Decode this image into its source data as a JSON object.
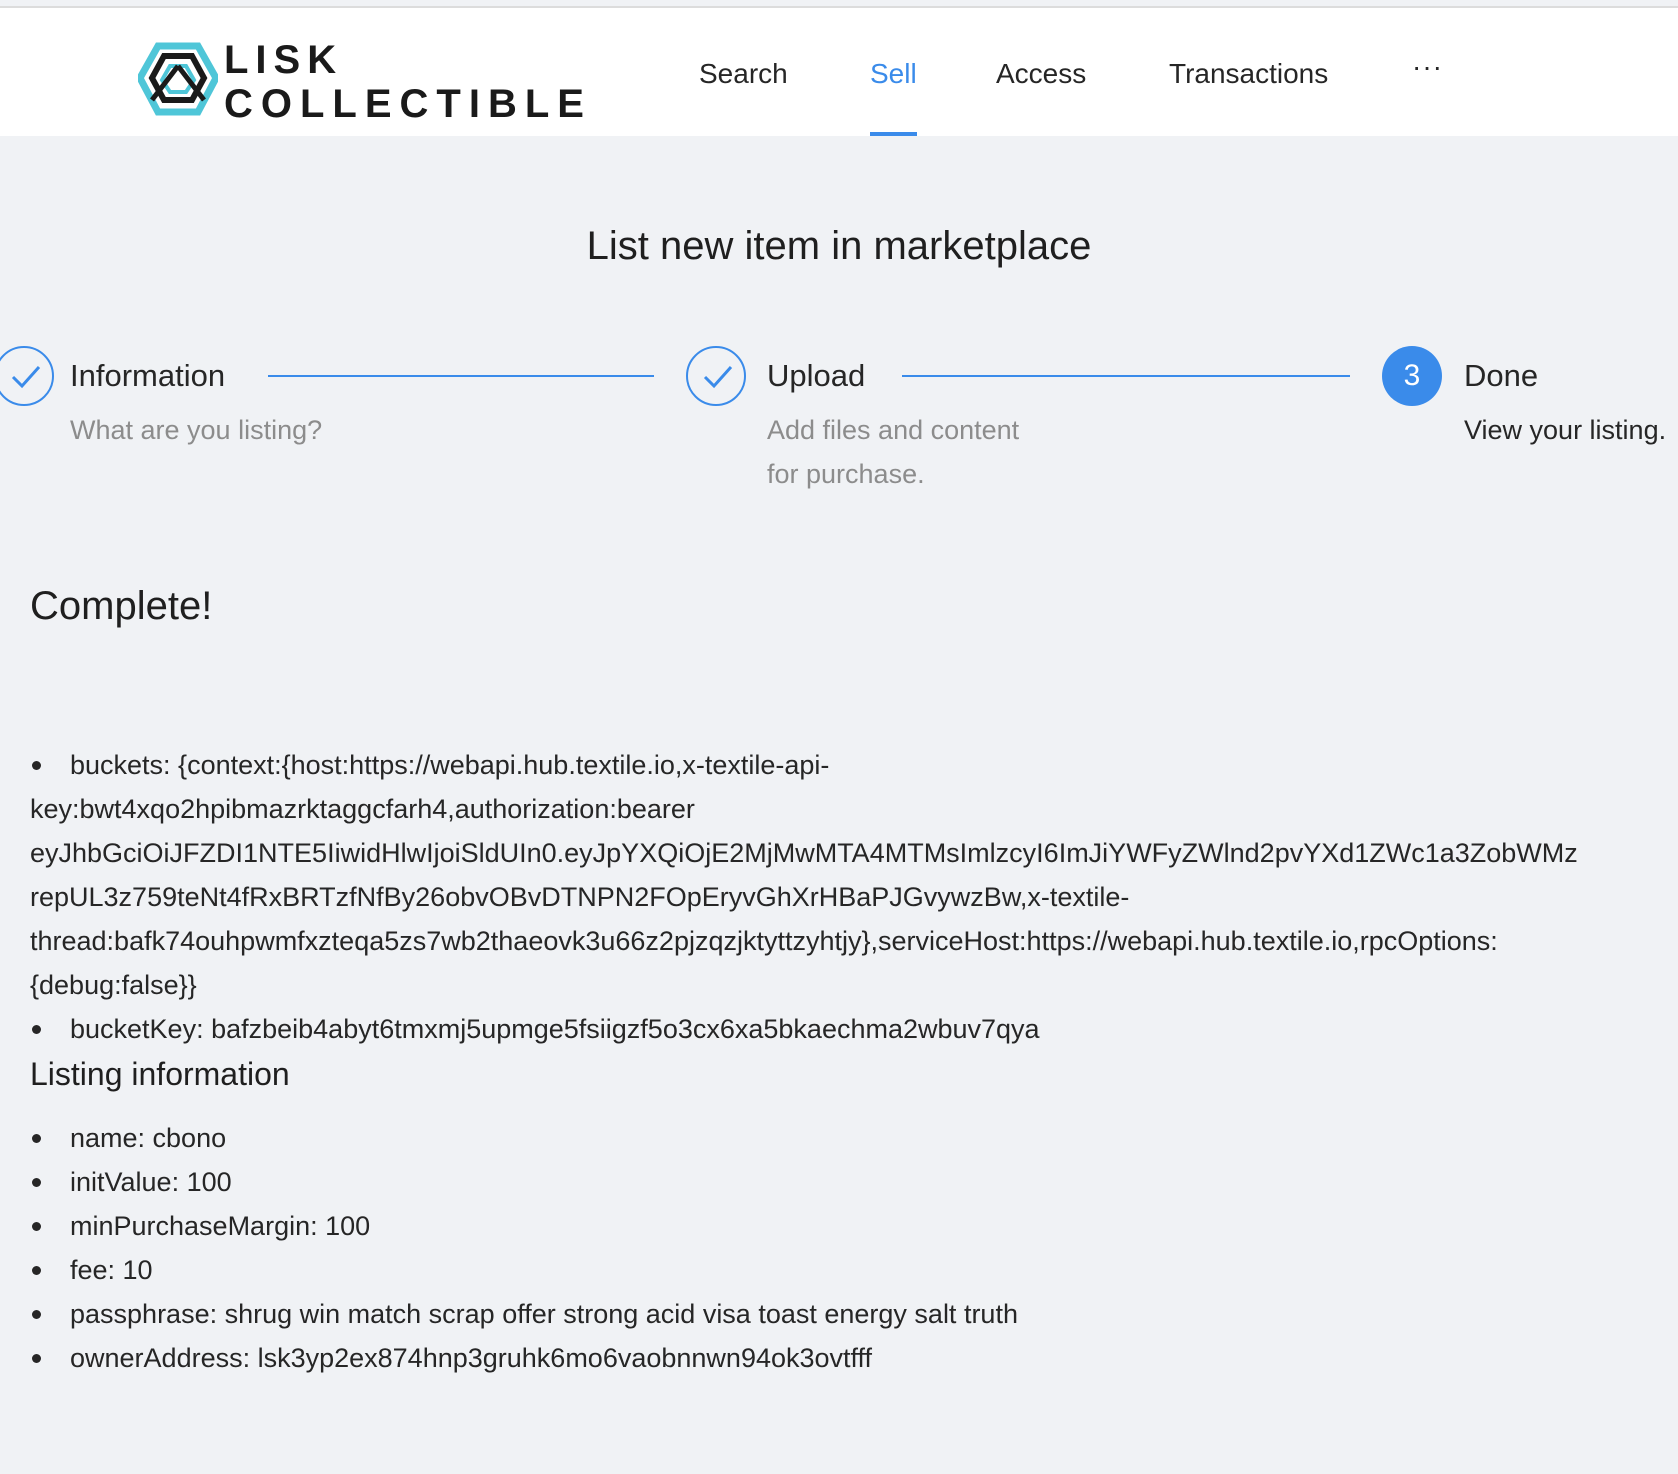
{
  "brand": {
    "line1": "LISK",
    "line2": "COLLECTIBLE",
    "accent_color": "#4fc6d8"
  },
  "nav": {
    "items": [
      "Search",
      "Sell",
      "Access",
      "Transactions"
    ],
    "active": "Sell",
    "more_label": "···"
  },
  "page": {
    "title": "List new item in marketplace"
  },
  "steps": [
    {
      "title": "Information",
      "description": "What are you listing?",
      "status": "done"
    },
    {
      "title": "Upload",
      "description_lines": [
        "Add files and content",
        "for purchase."
      ],
      "status": "done"
    },
    {
      "number": "3",
      "title": "Done",
      "description": "View your listing.",
      "status": "current"
    }
  ],
  "result": {
    "heading": "Complete!",
    "buckets_lines": [
      "buckets: {context:{host:https://webapi.hub.textile.io,x-textile-api-",
      "key:bwt4xqo2hpibmazrktaggcfarh4,authorization:bearer",
      "eyJhbGciOiJFZDI1NTE5IiwidHlwIjoiSldUIn0.eyJpYXQiOjE2MjMwMTA4MTMsImlzcyI6ImJiYWFyZWlnd2pvYXd1ZWc1a3ZobWMz",
      "repUL3z759teNt4fRxBRTzfNfBy26obvOBvDTNPN2FOpEryvGhXrHBaPJGvywzBw,x-textile-",
      "thread:bafk74ouhpwmfxzteqa5zs7wb2thaeovk3u66z2pjzqzjktyttzyhtjy},serviceHost:https://webapi.hub.textile.io,rpcOptions:",
      "{debug:false}}"
    ],
    "bucket_key": "bucketKey: bafzbeib4abyt6tmxmj5upmge5fsiigzf5o3cx6xa5bkaechma2wbuv7qya"
  },
  "listing": {
    "heading": "Listing information",
    "items": [
      "name: cbono",
      "initValue: 100",
      "minPurchaseMargin: 100",
      "fee: 10",
      "passphrase: shrug win match scrap offer strong acid visa toast energy salt truth",
      "ownerAddress: lsk3yp2ex874hnp3gruhk6mo6vaobnnwn94ok3ovtfff"
    ]
  },
  "colors": {
    "primary": "#3a8bea",
    "background": "#f0f2f5"
  }
}
